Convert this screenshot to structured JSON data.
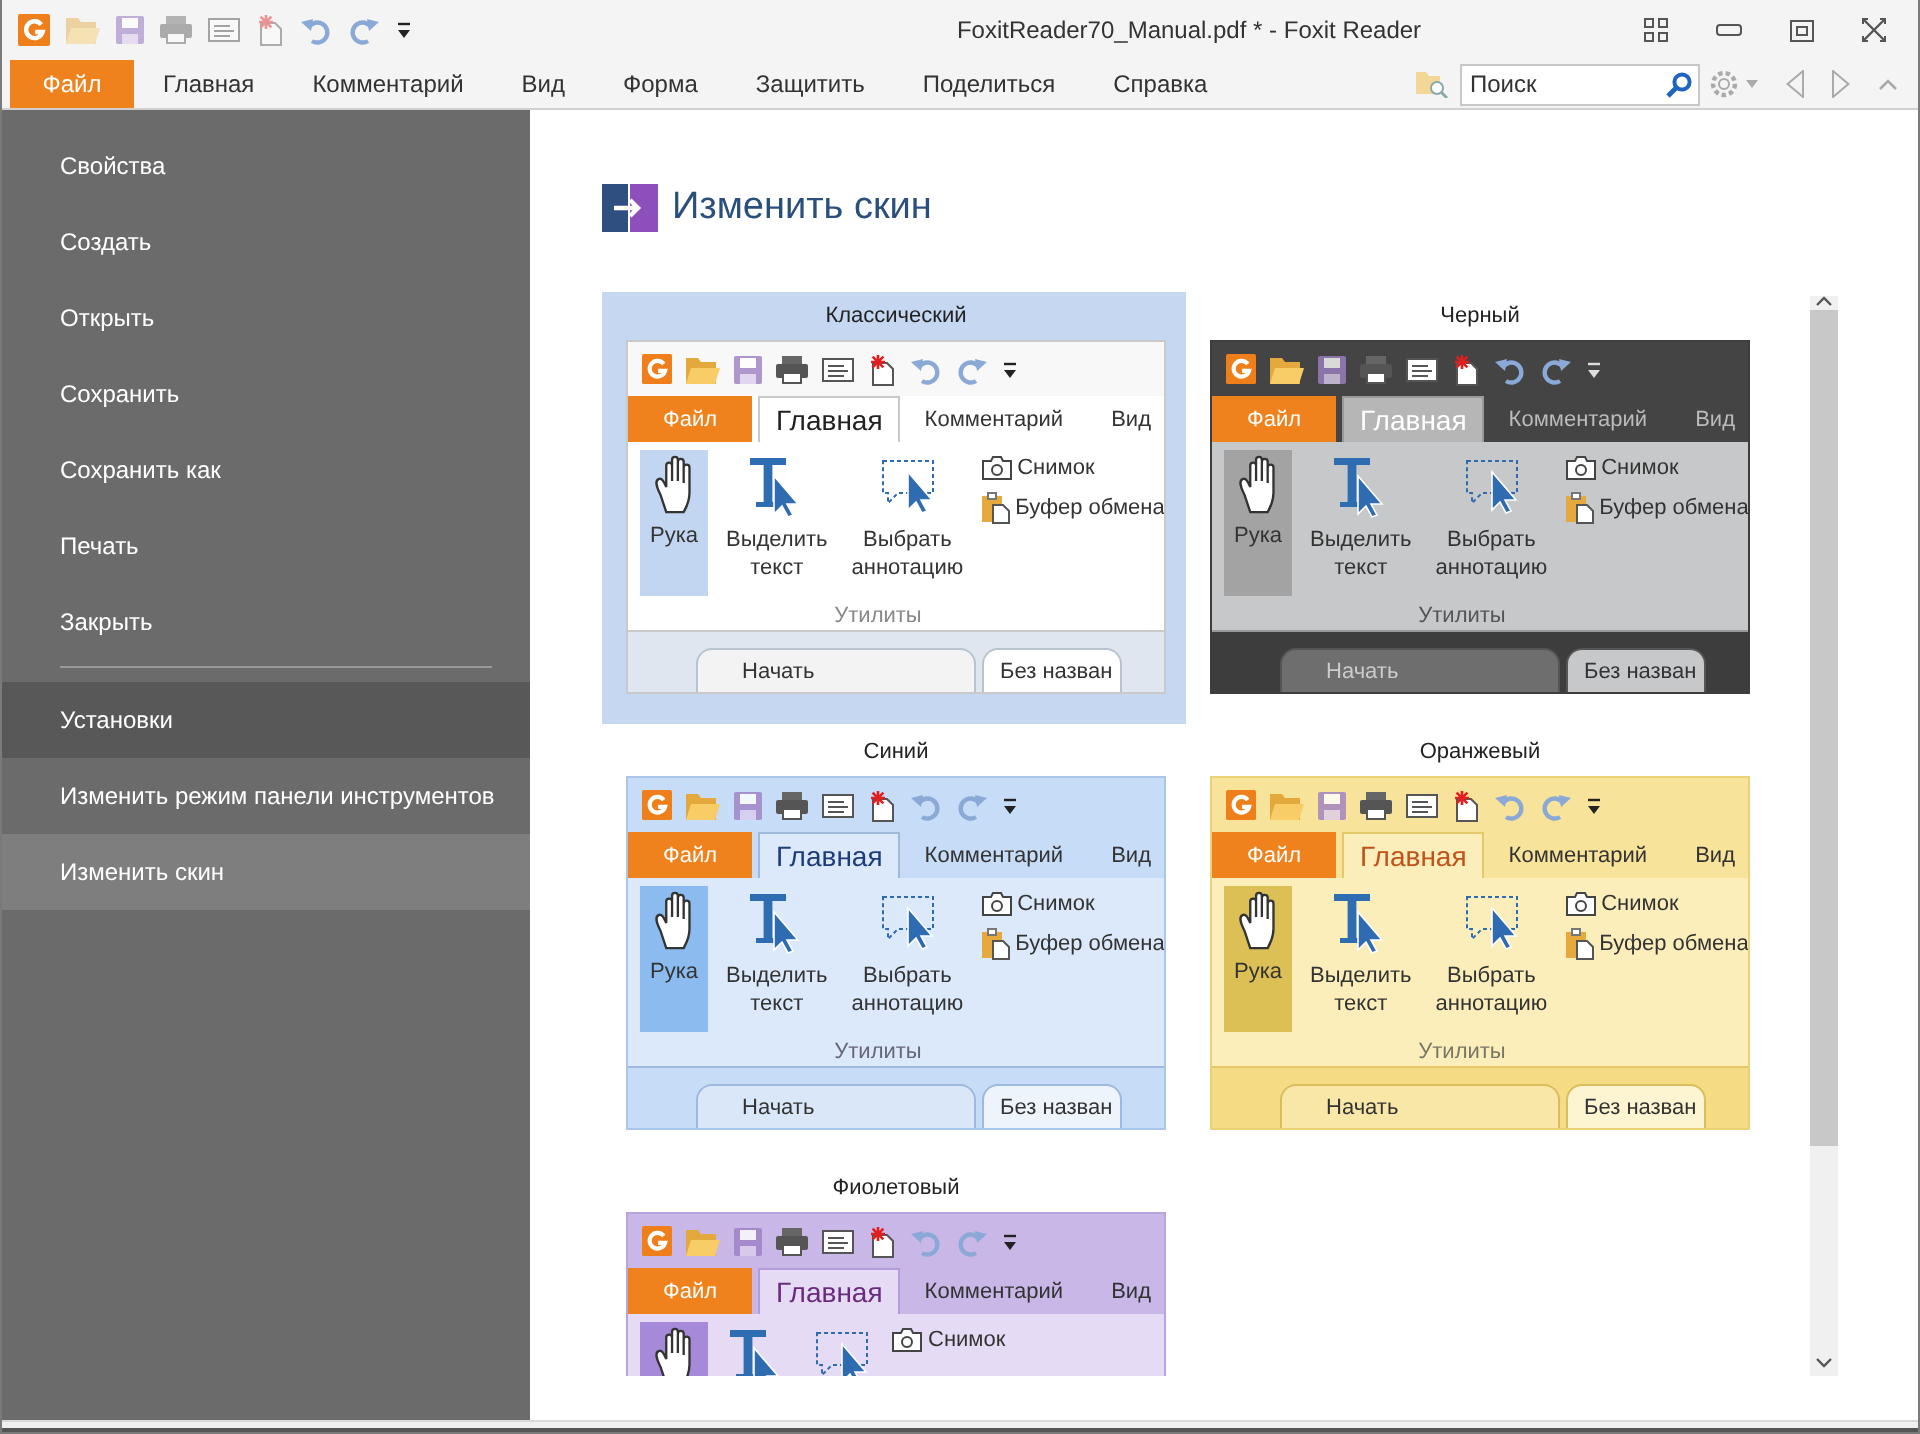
{
  "window": {
    "title": "FoxitReader70_Manual.pdf * - Foxit Reader"
  },
  "menu_tabs": [
    {
      "label": "Файл",
      "selected": true
    },
    {
      "label": "Главная",
      "selected": false
    },
    {
      "label": "Комментарий",
      "selected": false
    },
    {
      "label": "Вид",
      "selected": false
    },
    {
      "label": "Форма",
      "selected": false
    },
    {
      "label": "Защитить",
      "selected": false
    },
    {
      "label": "Поделиться",
      "selected": false
    },
    {
      "label": "Справка",
      "selected": false
    }
  ],
  "search": {
    "placeholder": "Поиск"
  },
  "sidebar": {
    "items": [
      {
        "label": "Свойства",
        "kind": "item",
        "selected": false
      },
      {
        "label": "Создать",
        "kind": "item",
        "selected": false
      },
      {
        "label": "Открыть",
        "kind": "item",
        "selected": false
      },
      {
        "label": "Сохранить",
        "kind": "item",
        "selected": false
      },
      {
        "label": "Сохранить как",
        "kind": "item",
        "selected": false
      },
      {
        "label": "Печать",
        "kind": "item",
        "selected": false
      },
      {
        "label": "Закрыть",
        "kind": "item",
        "selected": false
      },
      {
        "label": "Установки",
        "kind": "section",
        "selected": false
      },
      {
        "label": "Изменить режим панели инструментов",
        "kind": "item",
        "selected": false
      },
      {
        "label": "Изменить скин",
        "kind": "item",
        "selected": true
      }
    ]
  },
  "page": {
    "title": "Изменить скин"
  },
  "skins": [
    {
      "name": "Классический",
      "kind": "classic",
      "selected": true,
      "preview": {
        "file_tab": "Файл",
        "tabs": [
          {
            "label": "Главная",
            "selected": true
          },
          {
            "label": "Комментарий",
            "selected": false
          },
          {
            "label": "Вид",
            "selected": false
          }
        ],
        "tools": [
          {
            "kind": "hand",
            "label": "Рука",
            "selected": true
          },
          {
            "kind": "text-select",
            "label": "Выделить текст",
            "selected": false
          },
          {
            "kind": "annotation-select",
            "label": "Выбрать аннотацию",
            "selected": false
          }
        ],
        "small_tools": [
          "Снимок",
          "Буфер обмена"
        ],
        "group": "Утилиты",
        "doc_tabs": [
          {
            "label": "Начать",
            "selected": false
          },
          {
            "label": "Без назван",
            "selected": true
          }
        ]
      }
    },
    {
      "name": "Черный",
      "kind": "black",
      "selected": false,
      "preview": {
        "file_tab": "Файл",
        "tabs": [
          {
            "label": "Главная",
            "selected": true
          },
          {
            "label": "Комментарий",
            "selected": false
          },
          {
            "label": "Вид",
            "selected": false
          }
        ],
        "tools": [
          {
            "kind": "hand",
            "label": "Рука",
            "selected": true
          },
          {
            "kind": "text-select",
            "label": "Выделить текст",
            "selected": false
          },
          {
            "kind": "annotation-select",
            "label": "Выбрать аннотацию",
            "selected": false
          }
        ],
        "small_tools": [
          "Снимок",
          "Буфер обмена"
        ],
        "group": "Утилиты",
        "doc_tabs": [
          {
            "label": "Начать",
            "selected": false
          },
          {
            "label": "Без назван",
            "selected": true
          }
        ]
      }
    },
    {
      "name": "Синий",
      "kind": "blue",
      "selected": false,
      "preview": {
        "file_tab": "Файл",
        "tabs": [
          {
            "label": "Главная",
            "selected": true
          },
          {
            "label": "Комментарий",
            "selected": false
          },
          {
            "label": "Вид",
            "selected": false
          }
        ],
        "tools": [
          {
            "kind": "hand",
            "label": "Рука",
            "selected": true
          },
          {
            "kind": "text-select",
            "label": "Выделить текст",
            "selected": false
          },
          {
            "kind": "annotation-select",
            "label": "Выбрать аннотацию",
            "selected": false
          }
        ],
        "small_tools": [
          "Снимок",
          "Буфер обмена"
        ],
        "group": "Утилиты",
        "doc_tabs": [
          {
            "label": "Начать",
            "selected": false
          },
          {
            "label": "Без назван",
            "selected": true
          }
        ]
      }
    },
    {
      "name": "Оранжевый",
      "kind": "orange",
      "selected": false,
      "preview": {
        "file_tab": "Файл",
        "tabs": [
          {
            "label": "Главная",
            "selected": true
          },
          {
            "label": "Комментарий",
            "selected": false
          },
          {
            "label": "Вид",
            "selected": false
          }
        ],
        "tools": [
          {
            "kind": "hand",
            "label": "Рука",
            "selected": true
          },
          {
            "kind": "text-select",
            "label": "Выделить текст",
            "selected": false
          },
          {
            "kind": "annotation-select",
            "label": "Выбрать аннотацию",
            "selected": false
          }
        ],
        "small_tools": [
          "Снимок",
          "Буфер обмена"
        ],
        "group": "Утилиты",
        "doc_tabs": [
          {
            "label": "Начать",
            "selected": false
          },
          {
            "label": "Без назван",
            "selected": true
          }
        ]
      }
    },
    {
      "name": "Фиолетовый",
      "kind": "purple",
      "selected": false,
      "preview": {
        "file_tab": "Файл",
        "tabs": [
          {
            "label": "Главная",
            "selected": true
          },
          {
            "label": "Комментарий",
            "selected": false
          },
          {
            "label": "Вид",
            "selected": false
          }
        ],
        "tools": [
          {
            "kind": "hand",
            "selected": true
          },
          {
            "kind": "text-select",
            "selected": false
          },
          {
            "kind": "annotation-select",
            "selected": false
          }
        ],
        "small_tools": [
          "Снимок"
        ]
      }
    }
  ]
}
